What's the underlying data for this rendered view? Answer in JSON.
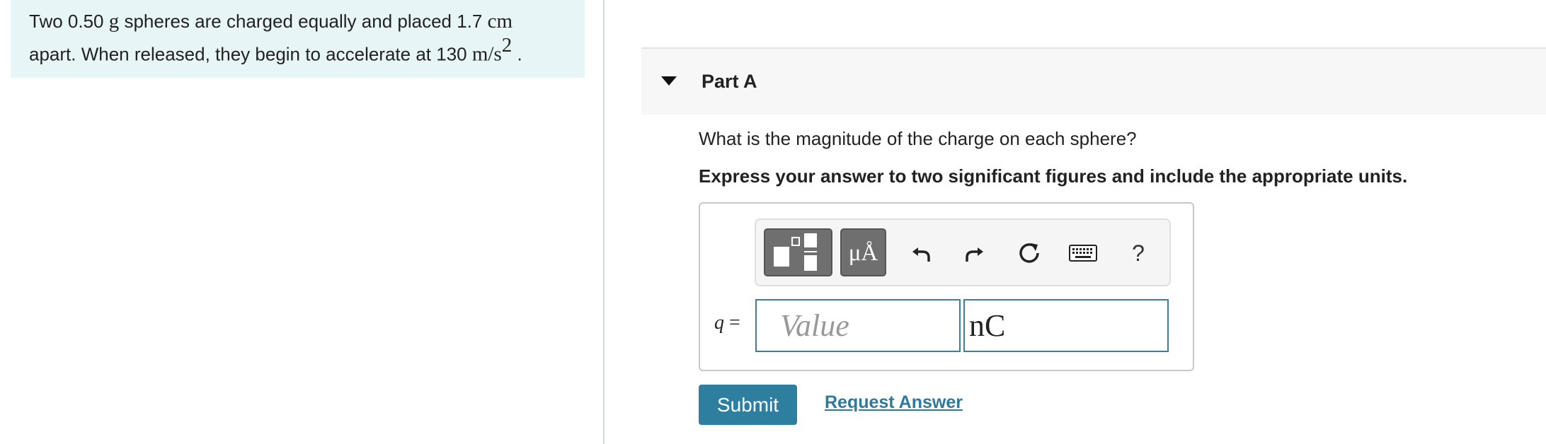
{
  "problem": {
    "line1_a": "Two 0.50 ",
    "line1_unit_g": "g",
    "line1_b": " spheres are charged equally and placed 1.7 ",
    "line1_unit_cm": "cm",
    "line2_a": "apart. When released, they begin to accelerate at 130 ",
    "line2_unit": "m/s",
    "line2_exp": "2",
    "line2_end": " ."
  },
  "part": {
    "title": "Part A",
    "question": "What is the magnitude of the charge on each sphere?",
    "instruction": "Express your answer to two significant figures and include the appropriate units."
  },
  "toolbar": {
    "units_label": "μÅ",
    "help_label": "?"
  },
  "answer": {
    "variable": "q",
    "equals": " =",
    "value_placeholder": "Value",
    "units_value": "nC"
  },
  "actions": {
    "submit_label": "Submit",
    "request_label": "Request Answer"
  },
  "colors": {
    "problem_bg": "#e8f5f6",
    "accent": "#2e7ea0",
    "input_border": "#3e7f98"
  }
}
